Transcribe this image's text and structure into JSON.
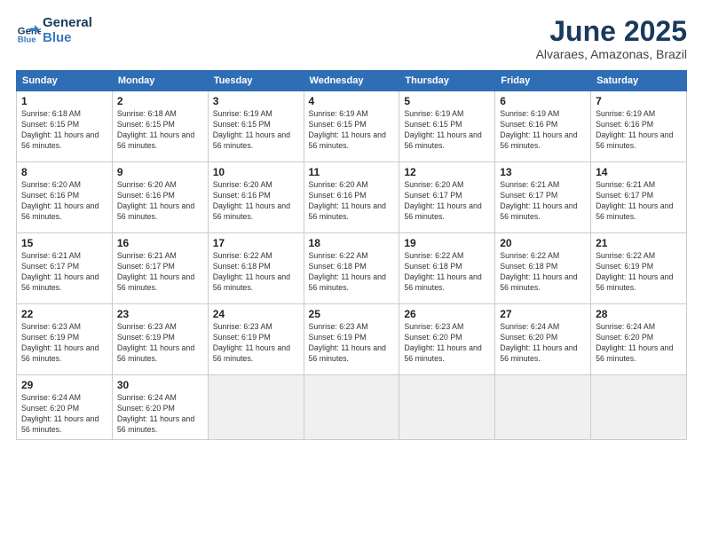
{
  "header": {
    "logo_line1": "General",
    "logo_line2": "Blue",
    "title": "June 2025",
    "subtitle": "Alvaraes, Amazonas, Brazil"
  },
  "weekdays": [
    "Sunday",
    "Monday",
    "Tuesday",
    "Wednesday",
    "Thursday",
    "Friday",
    "Saturday"
  ],
  "weeks": [
    [
      {
        "day": "1",
        "sunrise": "Sunrise: 6:18 AM",
        "sunset": "Sunset: 6:15 PM",
        "daylight": "Daylight: 11 hours and 56 minutes."
      },
      {
        "day": "2",
        "sunrise": "Sunrise: 6:18 AM",
        "sunset": "Sunset: 6:15 PM",
        "daylight": "Daylight: 11 hours and 56 minutes."
      },
      {
        "day": "3",
        "sunrise": "Sunrise: 6:19 AM",
        "sunset": "Sunset: 6:15 PM",
        "daylight": "Daylight: 11 hours and 56 minutes."
      },
      {
        "day": "4",
        "sunrise": "Sunrise: 6:19 AM",
        "sunset": "Sunset: 6:15 PM",
        "daylight": "Daylight: 11 hours and 56 minutes."
      },
      {
        "day": "5",
        "sunrise": "Sunrise: 6:19 AM",
        "sunset": "Sunset: 6:15 PM",
        "daylight": "Daylight: 11 hours and 56 minutes."
      },
      {
        "day": "6",
        "sunrise": "Sunrise: 6:19 AM",
        "sunset": "Sunset: 6:16 PM",
        "daylight": "Daylight: 11 hours and 56 minutes."
      },
      {
        "day": "7",
        "sunrise": "Sunrise: 6:19 AM",
        "sunset": "Sunset: 6:16 PM",
        "daylight": "Daylight: 11 hours and 56 minutes."
      }
    ],
    [
      {
        "day": "8",
        "sunrise": "Sunrise: 6:20 AM",
        "sunset": "Sunset: 6:16 PM",
        "daylight": "Daylight: 11 hours and 56 minutes."
      },
      {
        "day": "9",
        "sunrise": "Sunrise: 6:20 AM",
        "sunset": "Sunset: 6:16 PM",
        "daylight": "Daylight: 11 hours and 56 minutes."
      },
      {
        "day": "10",
        "sunrise": "Sunrise: 6:20 AM",
        "sunset": "Sunset: 6:16 PM",
        "daylight": "Daylight: 11 hours and 56 minutes."
      },
      {
        "day": "11",
        "sunrise": "Sunrise: 6:20 AM",
        "sunset": "Sunset: 6:16 PM",
        "daylight": "Daylight: 11 hours and 56 minutes."
      },
      {
        "day": "12",
        "sunrise": "Sunrise: 6:20 AM",
        "sunset": "Sunset: 6:17 PM",
        "daylight": "Daylight: 11 hours and 56 minutes."
      },
      {
        "day": "13",
        "sunrise": "Sunrise: 6:21 AM",
        "sunset": "Sunset: 6:17 PM",
        "daylight": "Daylight: 11 hours and 56 minutes."
      },
      {
        "day": "14",
        "sunrise": "Sunrise: 6:21 AM",
        "sunset": "Sunset: 6:17 PM",
        "daylight": "Daylight: 11 hours and 56 minutes."
      }
    ],
    [
      {
        "day": "15",
        "sunrise": "Sunrise: 6:21 AM",
        "sunset": "Sunset: 6:17 PM",
        "daylight": "Daylight: 11 hours and 56 minutes."
      },
      {
        "day": "16",
        "sunrise": "Sunrise: 6:21 AM",
        "sunset": "Sunset: 6:17 PM",
        "daylight": "Daylight: 11 hours and 56 minutes."
      },
      {
        "day": "17",
        "sunrise": "Sunrise: 6:22 AM",
        "sunset": "Sunset: 6:18 PM",
        "daylight": "Daylight: 11 hours and 56 minutes."
      },
      {
        "day": "18",
        "sunrise": "Sunrise: 6:22 AM",
        "sunset": "Sunset: 6:18 PM",
        "daylight": "Daylight: 11 hours and 56 minutes."
      },
      {
        "day": "19",
        "sunrise": "Sunrise: 6:22 AM",
        "sunset": "Sunset: 6:18 PM",
        "daylight": "Daylight: 11 hours and 56 minutes."
      },
      {
        "day": "20",
        "sunrise": "Sunrise: 6:22 AM",
        "sunset": "Sunset: 6:18 PM",
        "daylight": "Daylight: 11 hours and 56 minutes."
      },
      {
        "day": "21",
        "sunrise": "Sunrise: 6:22 AM",
        "sunset": "Sunset: 6:19 PM",
        "daylight": "Daylight: 11 hours and 56 minutes."
      }
    ],
    [
      {
        "day": "22",
        "sunrise": "Sunrise: 6:23 AM",
        "sunset": "Sunset: 6:19 PM",
        "daylight": "Daylight: 11 hours and 56 minutes."
      },
      {
        "day": "23",
        "sunrise": "Sunrise: 6:23 AM",
        "sunset": "Sunset: 6:19 PM",
        "daylight": "Daylight: 11 hours and 56 minutes."
      },
      {
        "day": "24",
        "sunrise": "Sunrise: 6:23 AM",
        "sunset": "Sunset: 6:19 PM",
        "daylight": "Daylight: 11 hours and 56 minutes."
      },
      {
        "day": "25",
        "sunrise": "Sunrise: 6:23 AM",
        "sunset": "Sunset: 6:19 PM",
        "daylight": "Daylight: 11 hours and 56 minutes."
      },
      {
        "day": "26",
        "sunrise": "Sunrise: 6:23 AM",
        "sunset": "Sunset: 6:20 PM",
        "daylight": "Daylight: 11 hours and 56 minutes."
      },
      {
        "day": "27",
        "sunrise": "Sunrise: 6:24 AM",
        "sunset": "Sunset: 6:20 PM",
        "daylight": "Daylight: 11 hours and 56 minutes."
      },
      {
        "day": "28",
        "sunrise": "Sunrise: 6:24 AM",
        "sunset": "Sunset: 6:20 PM",
        "daylight": "Daylight: 11 hours and 56 minutes."
      }
    ],
    [
      {
        "day": "29",
        "sunrise": "Sunrise: 6:24 AM",
        "sunset": "Sunset: 6:20 PM",
        "daylight": "Daylight: 11 hours and 56 minutes."
      },
      {
        "day": "30",
        "sunrise": "Sunrise: 6:24 AM",
        "sunset": "Sunset: 6:20 PM",
        "daylight": "Daylight: 11 hours and 56 minutes."
      },
      null,
      null,
      null,
      null,
      null
    ]
  ]
}
